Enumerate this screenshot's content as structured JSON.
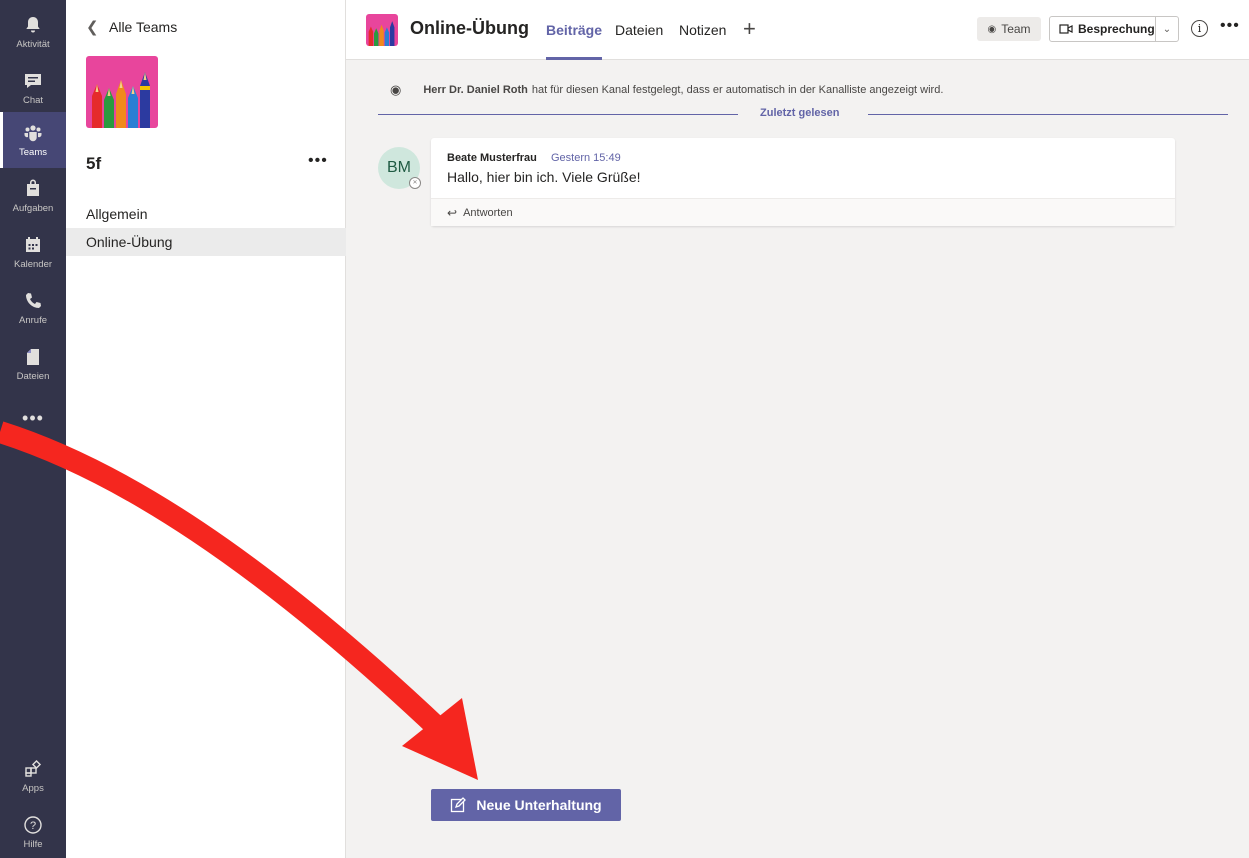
{
  "rail": {
    "items": [
      {
        "label": "Aktivität",
        "icon": "bell-icon"
      },
      {
        "label": "Chat",
        "icon": "chat-icon"
      },
      {
        "label": "Teams",
        "icon": "teams-icon"
      },
      {
        "label": "Aufgaben",
        "icon": "assignments-icon"
      },
      {
        "label": "Kalender",
        "icon": "calendar-icon"
      },
      {
        "label": "Anrufe",
        "icon": "phone-icon"
      },
      {
        "label": "Dateien",
        "icon": "files-icon"
      }
    ],
    "more": "•••",
    "bottom": [
      {
        "label": "Apps",
        "icon": "apps-icon"
      },
      {
        "label": "Hilfe",
        "icon": "help-icon"
      }
    ]
  },
  "team_panel": {
    "back_label": "Alle Teams",
    "team_name": "5f",
    "more": "•••",
    "channels": [
      "Allgemein",
      "Online-Übung"
    ]
  },
  "header": {
    "title": "Online-Übung",
    "tabs": [
      "Beiträge",
      "Dateien",
      "Notizen"
    ],
    "add_tab": "+",
    "team_button": "Team",
    "meeting_button": "Besprechung",
    "info": "i",
    "more": "•••"
  },
  "feed": {
    "system_message": {
      "author": "Herr Dr. Daniel Roth",
      "text": "hat für diesen Kanal festgelegt, dass er automatisch in der Kanalliste angezeigt wird."
    },
    "last_read": "Zuletzt gelesen",
    "post": {
      "initials": "BM",
      "author": "Beate Musterfrau",
      "time": "Gestern 15:49",
      "text": "Hallo, hier bin ich. Viele Grüße!",
      "reply_label": "Antworten"
    },
    "new_conversation": "Neue Unterhaltung"
  },
  "colors": {
    "rail": "#33344a",
    "accent": "#6264a7",
    "annotation_arrow": "#f5261f"
  }
}
